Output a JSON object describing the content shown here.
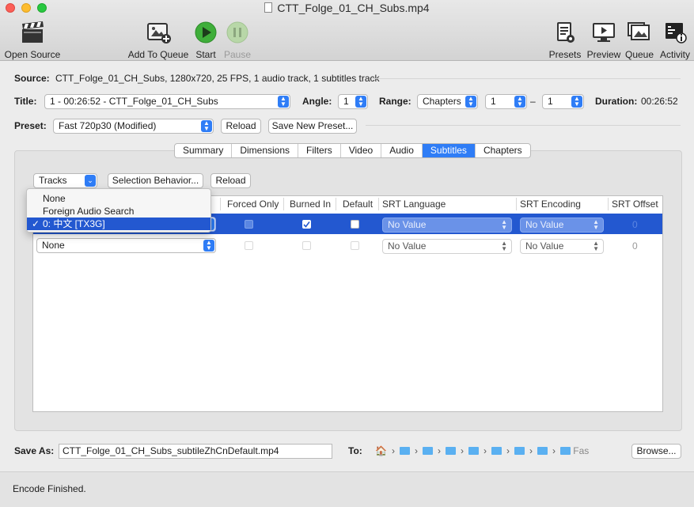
{
  "window": {
    "title": "CTT_Folge_01_CH_Subs.mp4"
  },
  "toolbar": {
    "open_source": "Open Source",
    "add_to_queue": "Add To Queue",
    "start": "Start",
    "pause": "Pause",
    "presets": "Presets",
    "preview": "Preview",
    "queue": "Queue",
    "activity": "Activity"
  },
  "source": {
    "label": "Source:",
    "value": "CTT_Folge_01_CH_Subs, 1280x720, 25 FPS, 1 audio track, 1 subtitles track"
  },
  "title_row": {
    "title_label": "Title:",
    "title_value": "1 - 00:26:52 - CTT_Folge_01_CH_Subs",
    "angle_label": "Angle:",
    "angle_value": "1",
    "range_label": "Range:",
    "range_value": "Chapters",
    "range_start": "1",
    "range_dash": "–",
    "range_end": "1",
    "duration_label": "Duration:",
    "duration_value": "00:26:52"
  },
  "preset_row": {
    "label": "Preset:",
    "value": "Fast 720p30 (Modified)",
    "reload": "Reload",
    "save_new": "Save New Preset..."
  },
  "tabs": [
    "Summary",
    "Dimensions",
    "Filters",
    "Video",
    "Audio",
    "Subtitles",
    "Chapters"
  ],
  "subtitles": {
    "tracks_popup": "Tracks",
    "selection_behavior": "Selection Behavior...",
    "reload": "Reload",
    "columns": [
      "Forced Only",
      "Burned In",
      "Default",
      "SRT Language",
      "SRT Encoding",
      "SRT Offset"
    ],
    "rows": [
      {
        "track": "0: 中文 [TX3G]",
        "srt_language": "No Value",
        "srt_encoding": "No Value",
        "srt_offset": "0"
      },
      {
        "track": "None",
        "srt_language": "No Value",
        "srt_encoding": "No Value",
        "srt_offset": "0"
      }
    ],
    "menu": {
      "items": [
        "None",
        "Foreign Audio Search",
        "0: 中文 [TX3G]"
      ],
      "check": "✓"
    }
  },
  "save": {
    "label": "Save As:",
    "filename": "CTT_Folge_01_CH_Subs_subtileZhCnDefault.mp4",
    "to_label": "To:",
    "path_tail": "Fas",
    "browse": "Browse..."
  },
  "status": {
    "text": "Encode Finished."
  },
  "colors": {
    "accent": "#2f7df6",
    "selection": "#2358d0",
    "folder": "#5ab0f1"
  }
}
